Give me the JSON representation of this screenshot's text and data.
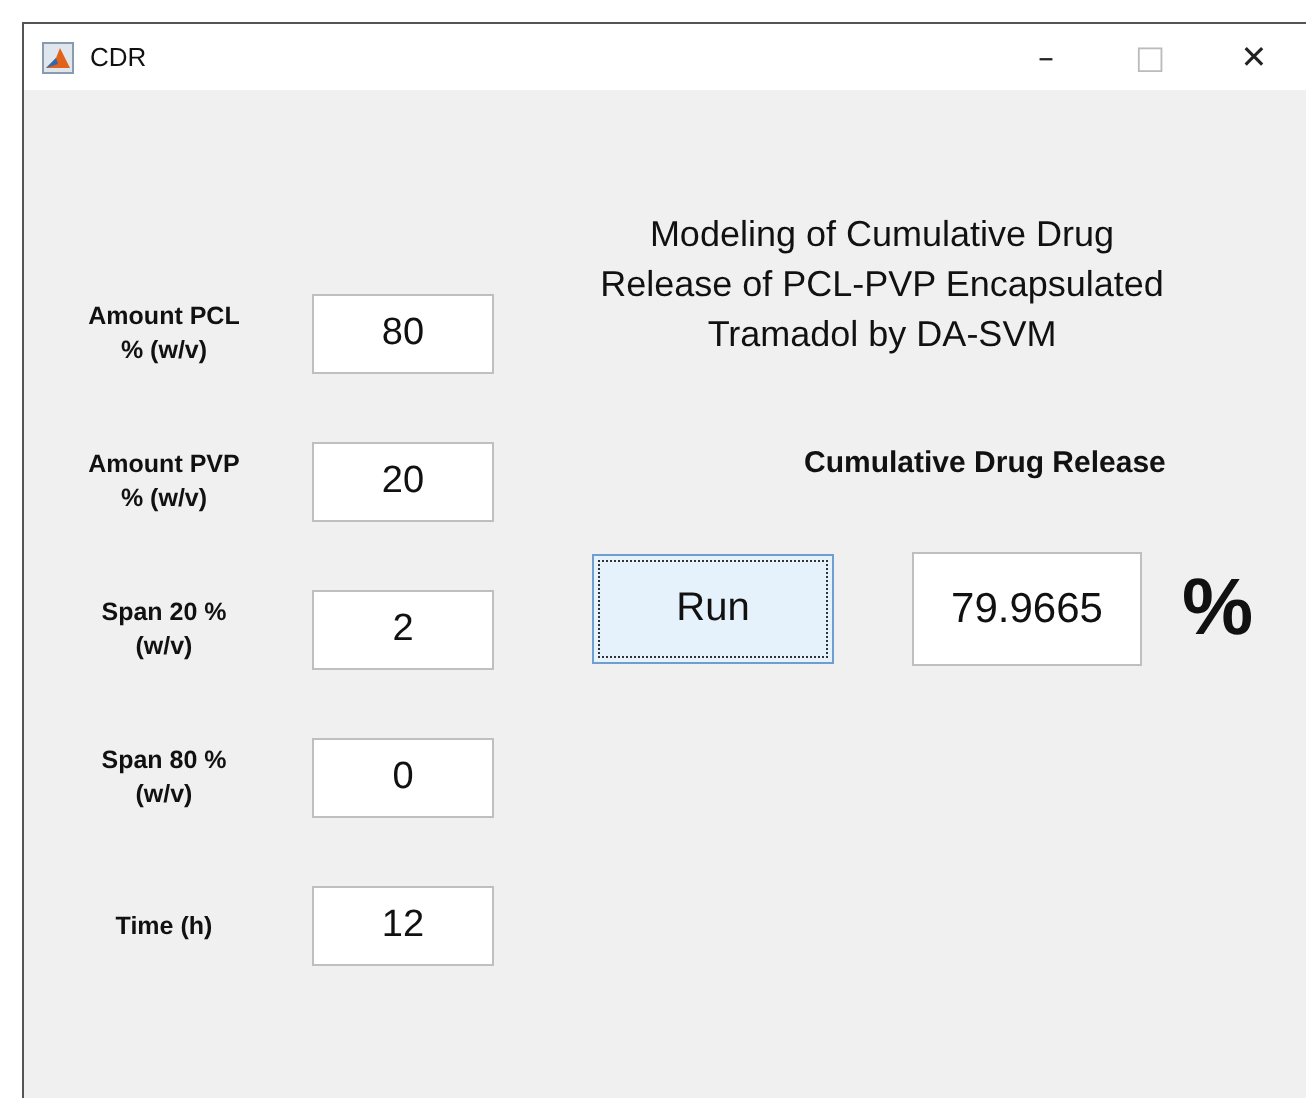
{
  "window": {
    "title": "CDR",
    "controls": [
      "–",
      "□",
      "✕"
    ]
  },
  "inputs": [
    {
      "label": "Amount PCL\n% (w/v)",
      "value": "80"
    },
    {
      "label": "Amount PVP\n% (w/v)",
      "value": "20"
    },
    {
      "label": "Span 20 %\n(w/v)",
      "value": "2"
    },
    {
      "label": "Span 80 %\n(w/v)",
      "value": "0"
    },
    {
      "label": "Time (h)",
      "value": "12"
    }
  ],
  "heading": "Modeling of Cumulative Drug Release of PCL-PVP Encapsulated Tramadol by DA-SVM",
  "output_label": "Cumulative Drug Release",
  "run_button": "Run",
  "output_value": "79.9665",
  "unit": "%"
}
